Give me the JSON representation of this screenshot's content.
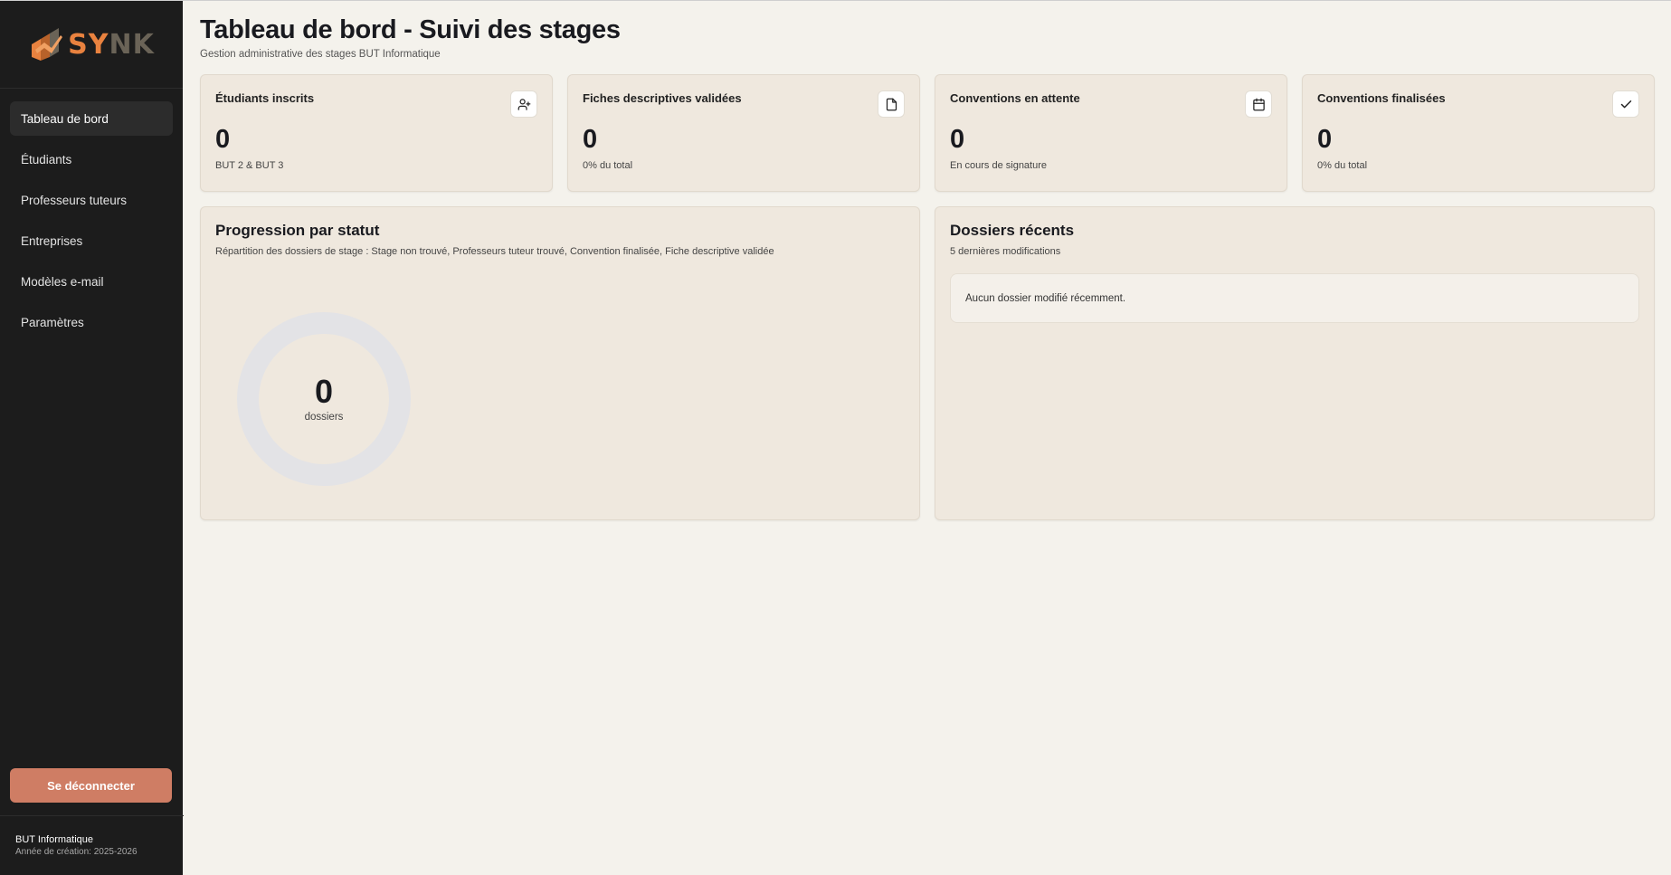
{
  "brand": {
    "logo_text_primary": "SY",
    "logo_text_secondary": "NK",
    "colors": {
      "accent": "#e9823f",
      "sidebar_bg": "#1c1c1c",
      "logout": "#cf7d64",
      "card_bg": "#efe8de"
    }
  },
  "sidebar": {
    "items": [
      {
        "label": "Tableau de bord",
        "active": true
      },
      {
        "label": "Étudiants"
      },
      {
        "label": "Professeurs tuteurs"
      },
      {
        "label": "Entreprises"
      },
      {
        "label": "Modèles e-mail"
      },
      {
        "label": "Paramètres"
      }
    ],
    "logout_label": "Se déconnecter",
    "footer": {
      "org": "BUT Informatique",
      "year": "Année de création: 2025-2026"
    }
  },
  "header": {
    "title": "Tableau de bord - Suivi des stages",
    "subtitle": "Gestion administrative des stages BUT Informatique"
  },
  "stats": [
    {
      "title": "Étudiants inscrits",
      "value": "0",
      "sub": "BUT 2 & BUT 3",
      "icon": "user-plus-icon"
    },
    {
      "title": "Fiches descriptives validées",
      "value": "0",
      "sub": "0% du total",
      "icon": "file-icon"
    },
    {
      "title": "Conventions en attente",
      "value": "0",
      "sub": "En cours de signature",
      "icon": "calendar-icon"
    },
    {
      "title": "Conventions finalisées",
      "value": "0",
      "sub": "0% du total",
      "icon": "check-icon"
    }
  ],
  "progression": {
    "title": "Progression par statut",
    "subtitle": "Répartition des dossiers de stage : Stage non trouvé, Professeurs tuteur trouvé, Convention finalisée, Fiche descriptive validée",
    "total_value": "0",
    "total_label": "dossiers"
  },
  "recent": {
    "title": "Dossiers récents",
    "subtitle": "5 dernières modifications",
    "empty_message": "Aucun dossier modifié récemment."
  },
  "chart_data": {
    "type": "pie",
    "categories": [
      "Stage non trouvé",
      "Professeurs tuteur trouvé",
      "Convention finalisée",
      "Fiche descriptive validée"
    ],
    "values": [
      0,
      0,
      0,
      0
    ],
    "title": "Progression par statut"
  }
}
